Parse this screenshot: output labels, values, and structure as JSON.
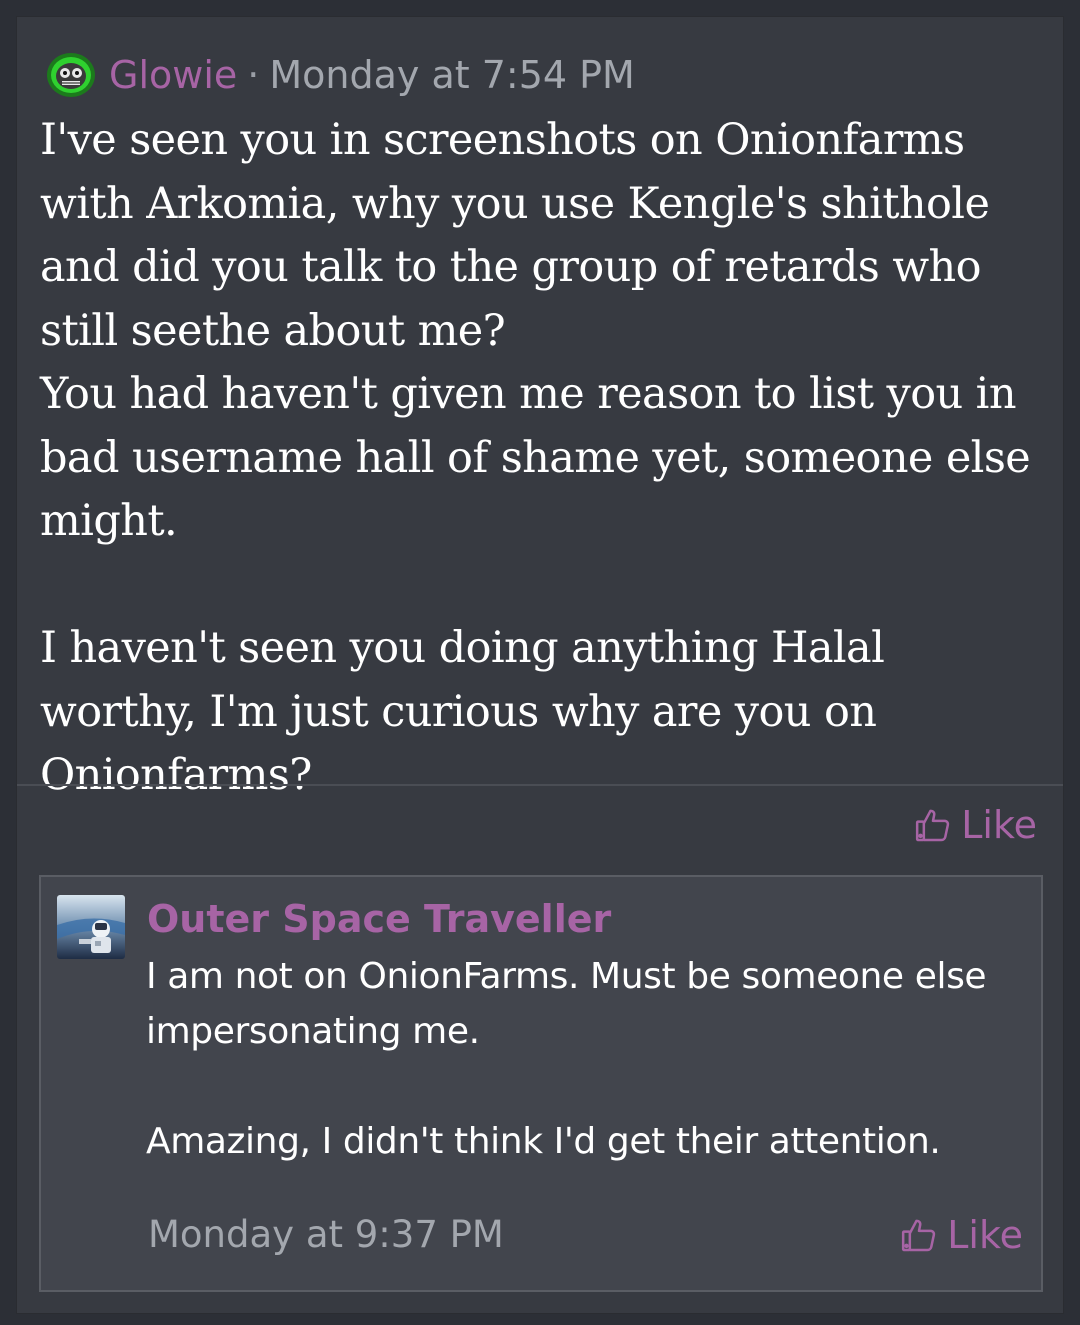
{
  "post": {
    "author": "Glowie",
    "separator": "·",
    "timestamp": "Monday at 7:54 PM",
    "body": {
      "paragraph1": "I've seen you in screenshots on Onionfarms with Arkomia, why you use Kengle's shithole and did you talk to the group of retards who still seethe about me?",
      "paragraph2": "You had haven't given me reason to list you in bad username hall of shame yet, someone else might.",
      "paragraph3": "I haven't seen you doing anything Halal worthy, I'm just curious why are you on Onionfarms?"
    },
    "like_label": "Like"
  },
  "comment": {
    "author": "Outer Space Traveller",
    "body": {
      "paragraph1": "I am not on OnionFarms. Must be someone else impersonating me.",
      "paragraph2": "Amazing, I didn't think I'd get their attention."
    },
    "timestamp": "Monday at 9:37 PM",
    "like_label": "Like"
  },
  "colors": {
    "page_background": "#2c2f36",
    "post_background": "#373a41",
    "comment_background": "#42454d",
    "accent_purple": "#a764a5",
    "muted_text": "#a3a7ae",
    "body_text": "#ffffff"
  },
  "icons": {
    "post_avatar": "glowie-avatar",
    "comment_avatar": "astronaut-avatar",
    "like": "thumbs-up-icon"
  }
}
